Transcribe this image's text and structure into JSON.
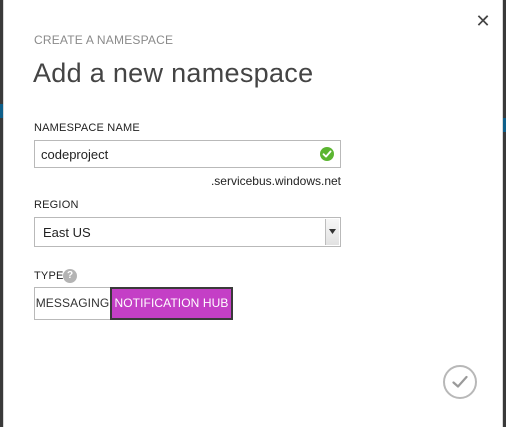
{
  "dialog": {
    "close_symbol": "✕",
    "eyebrow": "CREATE A NAMESPACE",
    "title": "Add a new namespace"
  },
  "namespace": {
    "label": "NAMESPACE NAME",
    "value": "codeproject",
    "suffix": ".servicebus.windows.net",
    "status_icon": "check-circle-icon",
    "status_color": "#5bb531"
  },
  "region": {
    "label": "REGION",
    "selected": "East US"
  },
  "type": {
    "label": "TYPE",
    "help_symbol": "?",
    "options": [
      {
        "label": "MESSAGING",
        "selected": false
      },
      {
        "label": "NOTIFICATION HUB",
        "selected": true
      }
    ],
    "selected_color": "#c43fc6"
  },
  "footer": {
    "confirm_icon": "checkmark-icon"
  }
}
